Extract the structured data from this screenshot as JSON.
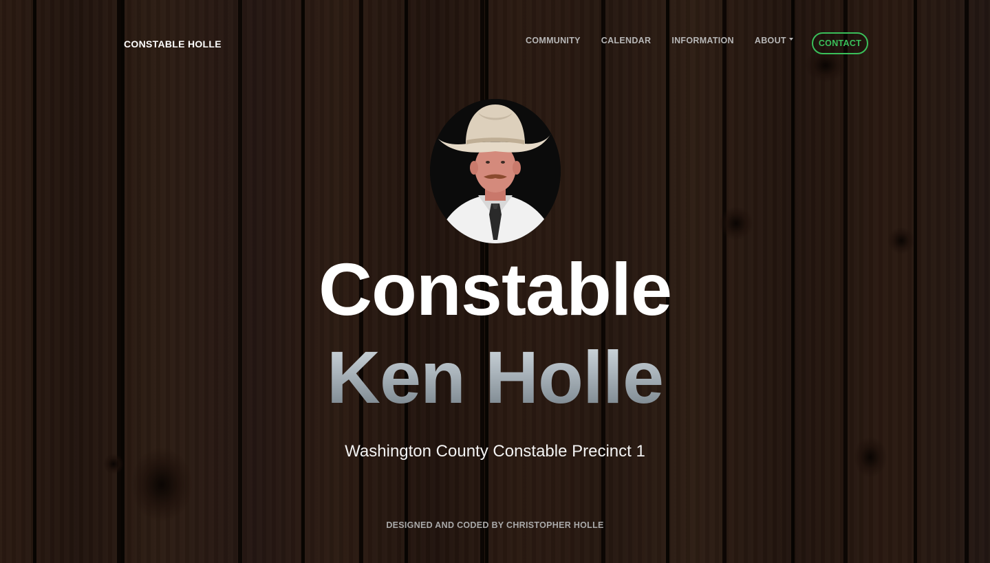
{
  "navbar": {
    "brand": "CONSTABLE HOLLE",
    "links": [
      {
        "label": "COMMUNITY"
      },
      {
        "label": "CALENDAR"
      },
      {
        "label": "INFORMATION"
      },
      {
        "label": "ABOUT"
      }
    ],
    "contact_label": "CONTACT"
  },
  "hero": {
    "title_line1": "Constable",
    "title_line2": "Ken Holle",
    "subtitle": "Washington County Constable Precinct 1"
  },
  "footer": {
    "credit": "DESIGNED AND CODED BY CHRISTOPHER HOLLE"
  },
  "colors": {
    "accent": "#3ac05a",
    "nav_text": "#b7b7b7",
    "background_wood": "#3a2418"
  },
  "icons": {
    "about_dropdown": "caret-down-icon"
  }
}
